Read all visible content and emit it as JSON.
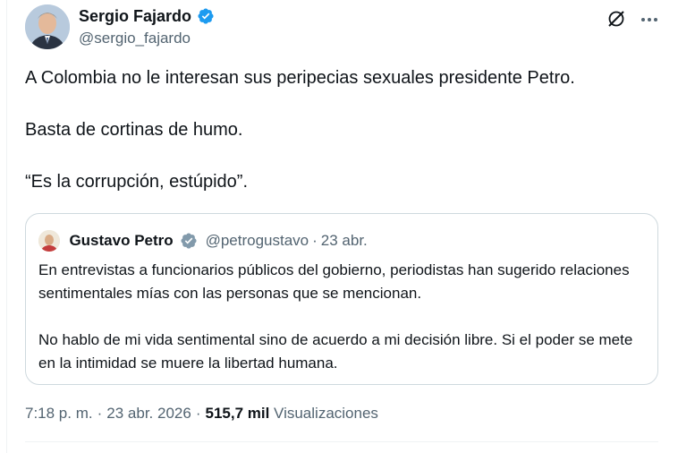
{
  "author": {
    "name": "Sergio Fajardo",
    "handle": "@sergio_fajardo"
  },
  "tweet": {
    "paragraphs": [
      "A Colombia no le interesan sus peripecias sexuales presidente Petro.",
      "Basta de cortinas de humo.",
      "“Es la corrupción, estúpido”."
    ]
  },
  "quoted_tweet": {
    "author_name": "Gustavo Petro",
    "handle": "@petrogustavo",
    "separator": "·",
    "date": "23 abr.",
    "paragraphs": [
      "En entrevistas a funcionarios públicos del gobierno, periodistas han sugerido relaciones sentimentales mías con las personas que se mencionan.",
      "No hablo de mi vida sentimental sino de acuerdo a mi decisión libre. Si el poder se mete en la intimidad se muere la libertad humana."
    ]
  },
  "meta": {
    "time": "7:18 p. m.",
    "separator": "·",
    "date": "23 abr. 2026",
    "views_count": "515,7 mil",
    "views_label": "Visualizaciones"
  },
  "icons": {
    "verified": "verified-badge-icon",
    "grok": "grok-icon",
    "more": "more-options-icon"
  },
  "colors": {
    "verified_blue": "#1d9bf0",
    "secondary_text": "#536471",
    "border": "#cfd9de"
  }
}
